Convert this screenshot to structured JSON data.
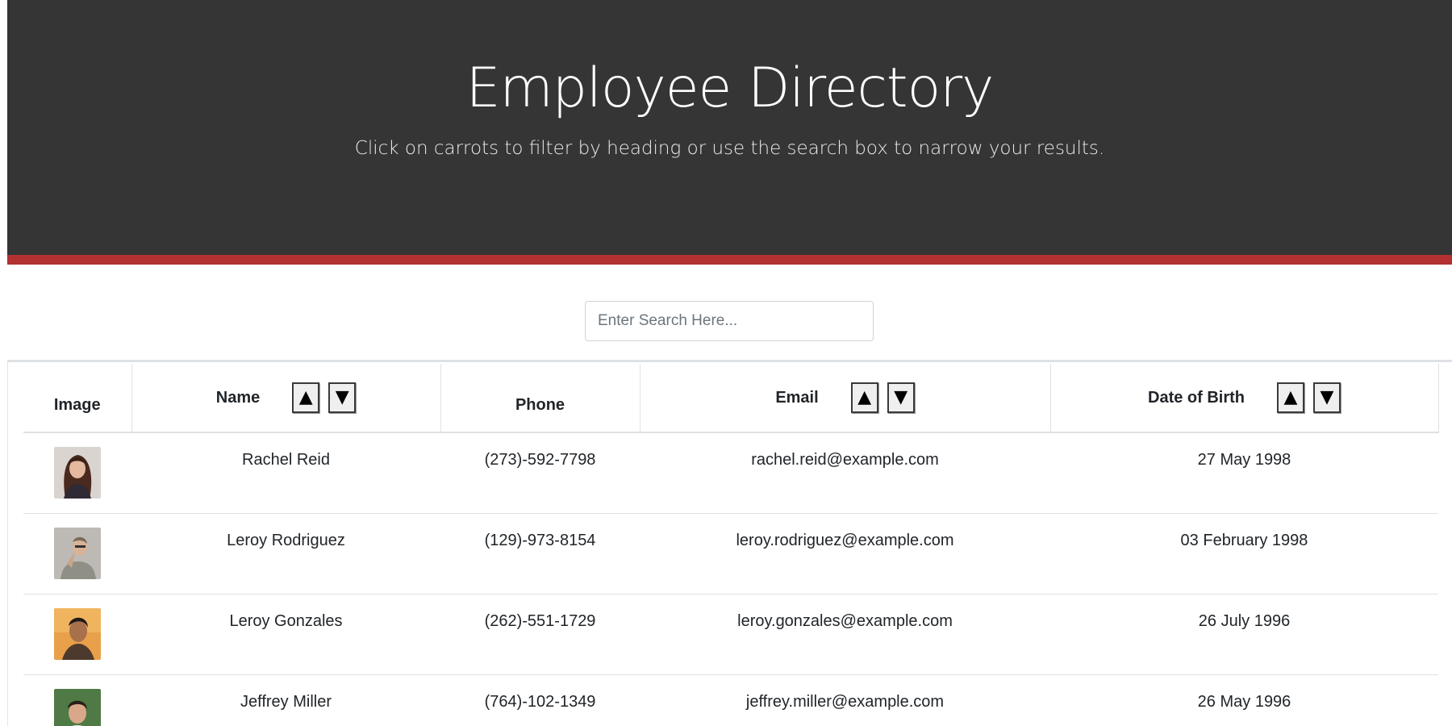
{
  "header": {
    "title": "Employee Directory",
    "subtitle": "Click on carrots to filter by heading or use the search box to narrow your results."
  },
  "search": {
    "placeholder": "Enter Search Here...",
    "value": ""
  },
  "table": {
    "columns": {
      "image": "Image",
      "name": "Name",
      "phone": "Phone",
      "email": "Email",
      "dob": "Date of Birth"
    },
    "sort_up_glyph": "▲",
    "sort_down_glyph": "▼",
    "rows": [
      {
        "name": "Rachel Reid",
        "phone": "(273)-592-7798",
        "email": "rachel.reid@example.com",
        "dob": "27 May 1998",
        "avatar_icon": "woman-portrait-icon"
      },
      {
        "name": "Leroy Rodriguez",
        "phone": "(129)-973-8154",
        "email": "leroy.rodriguez@example.com",
        "dob": "03 February 1998",
        "avatar_icon": "man-portrait-icon"
      },
      {
        "name": "Leroy Gonzales",
        "phone": "(262)-551-1729",
        "email": "leroy.gonzales@example.com",
        "dob": "26 July 1996",
        "avatar_icon": "man-portrait-icon"
      },
      {
        "name": "Jeffrey Miller",
        "phone": "(764)-102-1349",
        "email": "jeffrey.miller@example.com",
        "dob": "26 May 1996",
        "avatar_icon": "man-portrait-icon"
      }
    ]
  },
  "colors": {
    "hero_bg": "#353535",
    "accent_bar": "#b33131"
  }
}
